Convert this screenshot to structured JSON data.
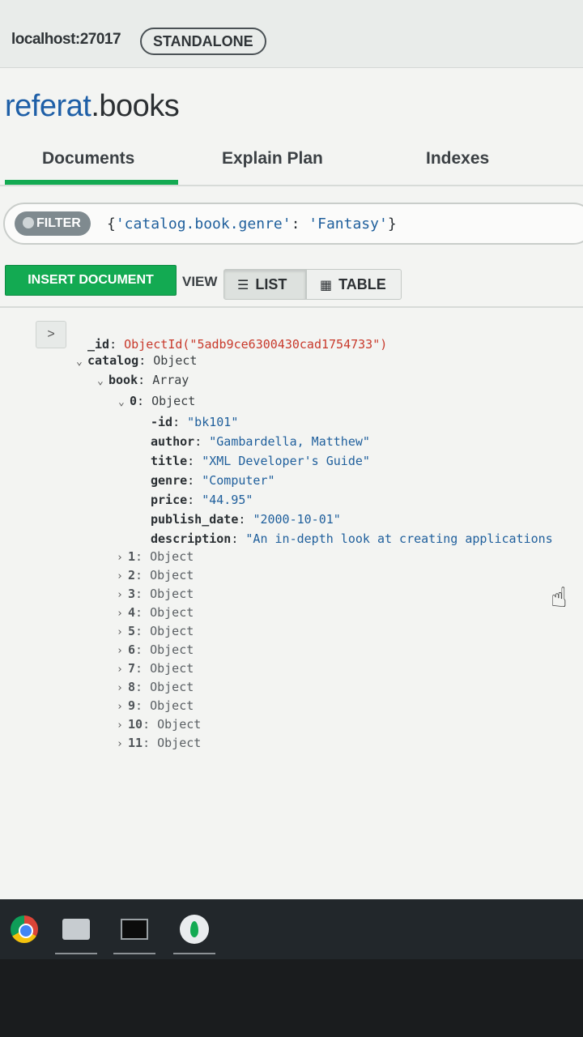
{
  "header": {
    "host": "localhost:27017",
    "mode_badge": "STANDALONE"
  },
  "namespace": {
    "db": "referat",
    "separator": ".",
    "collection": "books"
  },
  "tabs": [
    {
      "label": "Documents",
      "active": true
    },
    {
      "label": "Explain Plan",
      "active": false
    },
    {
      "label": "Indexes",
      "active": false
    }
  ],
  "filter": {
    "label": "FILTER",
    "query_open": "{",
    "query_key": "'catalog.book.genre'",
    "query_colon": ": ",
    "query_value": "'Fantasy'",
    "query_close": "}"
  },
  "toolbar": {
    "insert_label": "INSERT DOCUMENT",
    "view_label": "VIEW",
    "list_label": "LIST",
    "table_label": "TABLE",
    "active_view": "LIST"
  },
  "document": {
    "expand_glyph": ">",
    "id_key": "_id",
    "id_value": "ObjectId(\"5adb9ce6300430cad1754733\")",
    "catalog_key": "catalog",
    "catalog_type": "Object",
    "book_key": "book",
    "book_type": "Array",
    "item0_key": "0",
    "item0_type": "Object",
    "fields": [
      {
        "key": "-id",
        "value": "\"bk101\""
      },
      {
        "key": "author",
        "value": "\"Gambardella, Matthew\""
      },
      {
        "key": "title",
        "value": "\"XML Developer's Guide\""
      },
      {
        "key": "genre",
        "value": "\"Computer\""
      },
      {
        "key": "price",
        "value": "\"44.95\""
      },
      {
        "key": "publish_date",
        "value": "\"2000-10-01\""
      },
      {
        "key": "description",
        "value": "\"An in-depth look at creating applications"
      }
    ],
    "collapsed_items": [
      {
        "key": "1",
        "type": "Object"
      },
      {
        "key": "2",
        "type": "Object"
      },
      {
        "key": "3",
        "type": "Object"
      },
      {
        "key": "4",
        "type": "Object"
      },
      {
        "key": "5",
        "type": "Object"
      },
      {
        "key": "6",
        "type": "Object"
      },
      {
        "key": "7",
        "type": "Object"
      },
      {
        "key": "8",
        "type": "Object"
      },
      {
        "key": "9",
        "type": "Object"
      },
      {
        "key": "10",
        "type": "Object"
      },
      {
        "key": "11",
        "type": "Object"
      }
    ]
  },
  "taskbar": {
    "apps": [
      "chrome-icon",
      "files-icon",
      "terminal-icon",
      "mongodb-compass-icon"
    ]
  },
  "colors": {
    "accent_green": "#13aa52",
    "db_blue": "#1e5fa7",
    "objectid_red": "#c8392b",
    "string_blue": "#1f5f9c"
  }
}
